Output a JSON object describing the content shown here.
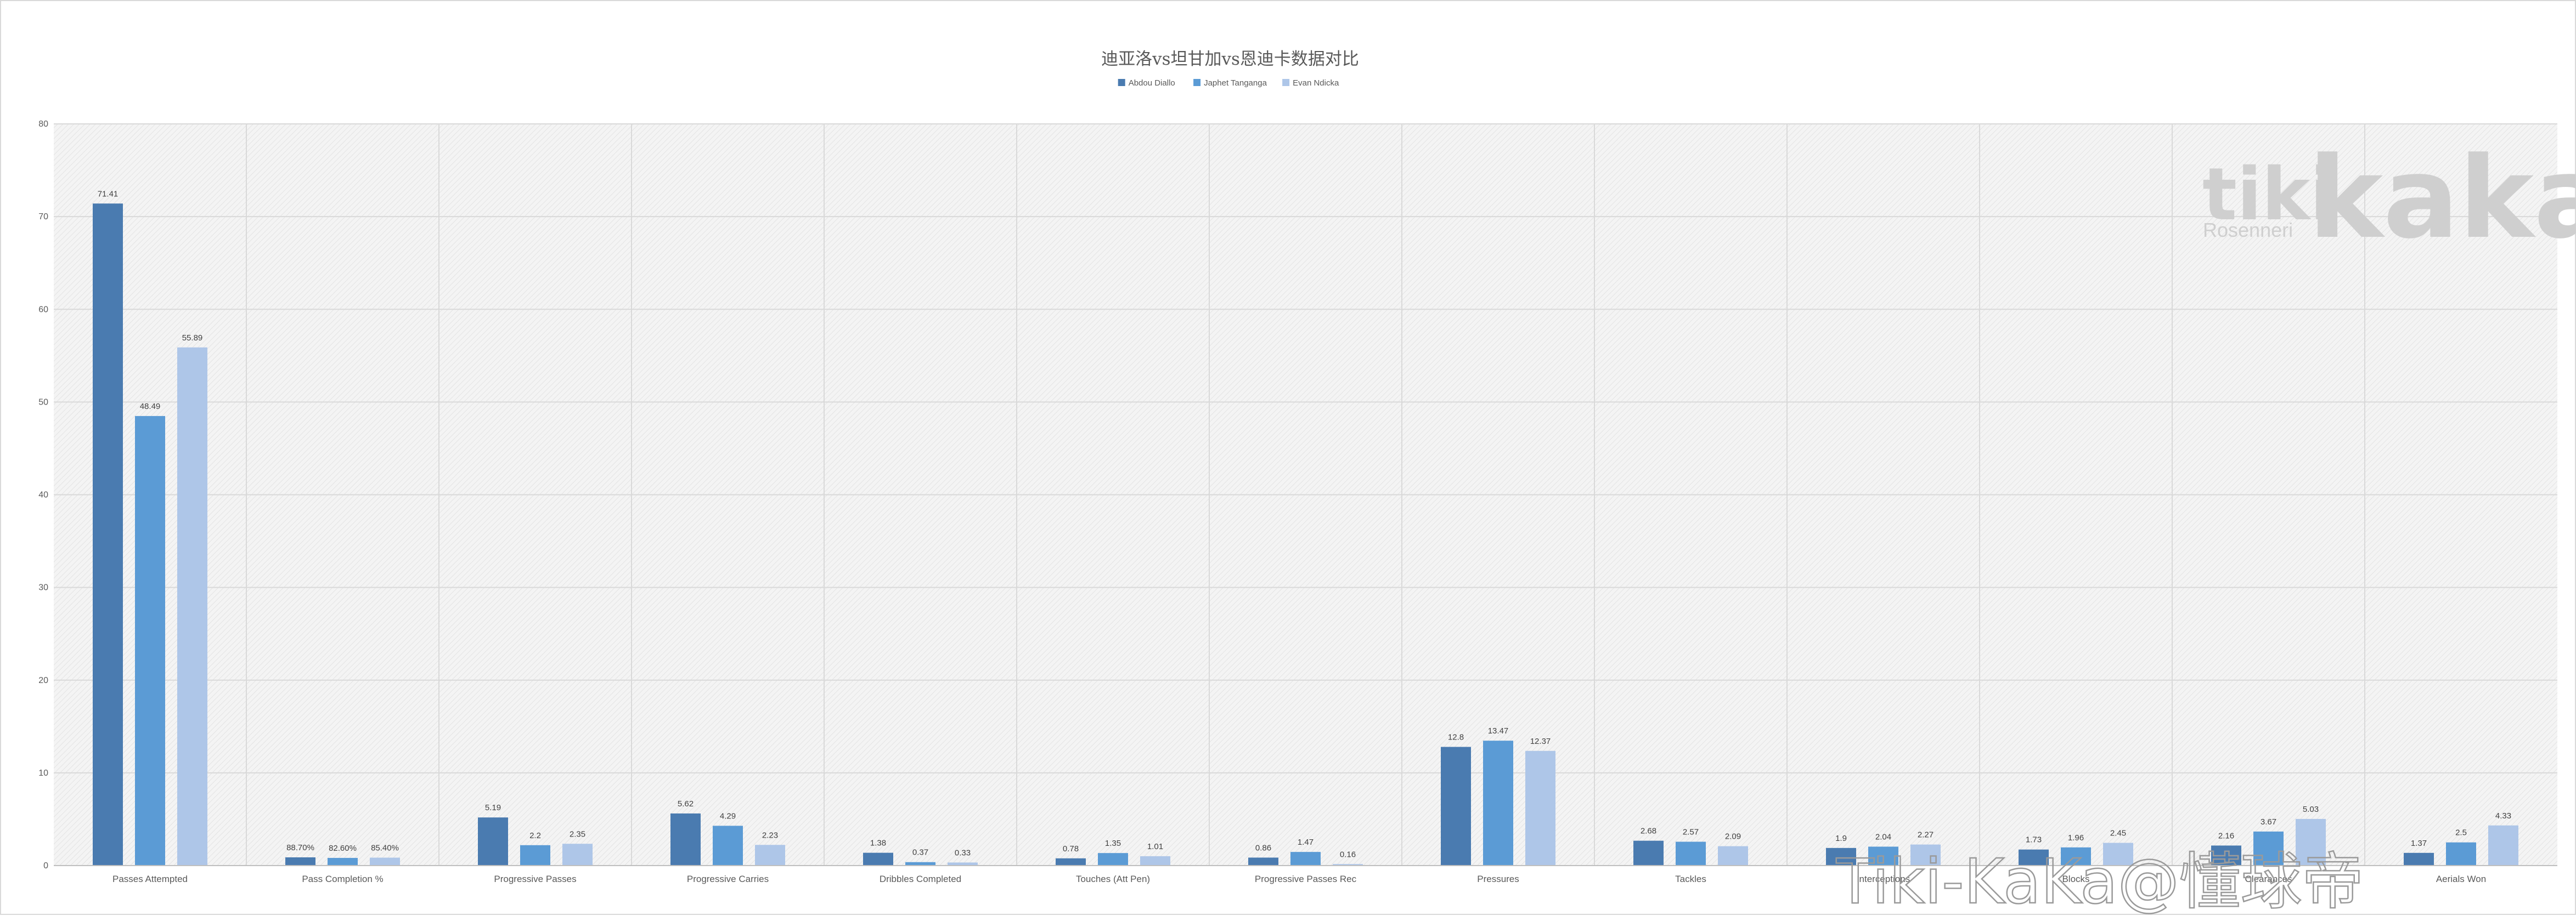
{
  "chart_data": {
    "type": "bar",
    "title": "迪亚洛vs坦甘加vs恩迪卡数据对比",
    "xlabel": "",
    "ylabel": "",
    "ylim": [
      0,
      80
    ],
    "yticks": [
      0,
      10,
      20,
      30,
      40,
      50,
      60,
      70,
      80
    ],
    "grid": true,
    "legend_position": "top-center",
    "categories": [
      "Passes Attempted",
      "Pass Completion %",
      "Progressive Passes",
      "Progressive Carries",
      "Dribbles Completed",
      "Touches (Att Pen)",
      "Progressive Passes Rec",
      "Pressures",
      "Tackles",
      "Interceptions",
      "Blocks",
      "Clearances",
      "Aerials Won"
    ],
    "series": [
      {
        "name": "Abdou Diallo",
        "color": "#4a7bb0",
        "values": [
          71.41,
          0.887,
          5.19,
          5.62,
          1.38,
          0.78,
          0.86,
          12.8,
          2.68,
          1.9,
          1.73,
          2.16,
          1.37
        ],
        "labels": [
          "71.41",
          "88.70%",
          "5.19",
          "5.62",
          "1.38",
          "0.78",
          "0.86",
          "12.8",
          "2.68",
          "1.9",
          "1.73",
          "2.16",
          "1.37"
        ]
      },
      {
        "name": "Japhet Tanganga",
        "color": "#5b9bd5",
        "values": [
          48.49,
          0.826,
          2.2,
          4.29,
          0.37,
          1.35,
          1.47,
          13.47,
          2.57,
          2.04,
          1.96,
          3.67,
          2.5
        ],
        "labels": [
          "48.49",
          "82.60%",
          "2.2",
          "4.29",
          "0.37",
          "1.35",
          "1.47",
          "13.47",
          "2.57",
          "2.04",
          "1.96",
          "3.67",
          "2.5"
        ]
      },
      {
        "name": "Evan Ndicka",
        "color": "#aec6e8",
        "values": [
          55.89,
          0.854,
          2.35,
          2.23,
          0.33,
          1.01,
          0.16,
          12.37,
          2.09,
          2.27,
          2.45,
          5.03,
          4.33
        ],
        "labels": [
          "55.89",
          "85.40%",
          "2.35",
          "2.23",
          "0.33",
          "1.01",
          "0.16",
          "12.37",
          "2.09",
          "2.27",
          "2.45",
          "5.03",
          "4.33"
        ]
      }
    ]
  },
  "watermarks": {
    "brand_left": "tiki",
    "brand_right": "kaka",
    "brand_sub": "Rosenneri",
    "credit": "Tiki-KaKa@懂球帝"
  }
}
